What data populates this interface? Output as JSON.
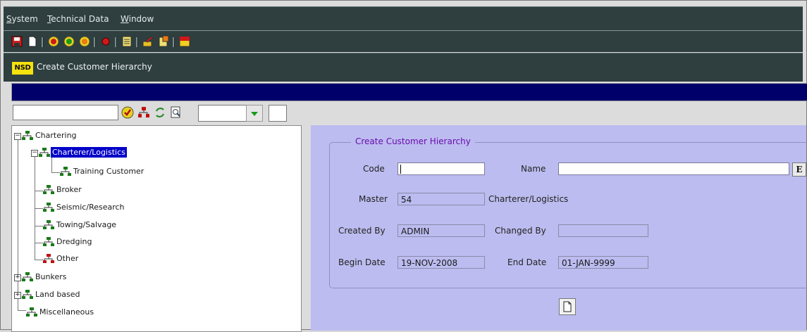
{
  "menu": {
    "system": "System",
    "technical_data": "Technical Data",
    "window": "Window"
  },
  "toolbar": {
    "icons": [
      "save-icon",
      "new-document-icon",
      "first-record-icon",
      "previous-record-icon",
      "next-record-icon",
      "stop-icon",
      "list-icon",
      "edit-icon",
      "attach-icon",
      "exit-icon"
    ]
  },
  "window": {
    "logo": "NSD",
    "title": "Create Customer Hierarchy"
  },
  "tree": {
    "nodes": [
      {
        "label": "Chartering",
        "expanded": true
      },
      {
        "label": "Charterer/Logistics",
        "selected": true,
        "expanded": true
      },
      {
        "label": "Training Customer"
      },
      {
        "label": "Broker"
      },
      {
        "label": "Seismic/Research"
      },
      {
        "label": "Towing/Salvage"
      },
      {
        "label": "Dredging"
      },
      {
        "label": "Other"
      },
      {
        "label": "Bunkers",
        "expanded": false
      },
      {
        "label": "Land based",
        "expanded": false
      },
      {
        "label": "Miscellaneous"
      }
    ]
  },
  "form": {
    "group_title": "Create Customer Hierarchy",
    "code_label": "Code",
    "code_value": "",
    "name_label": "Name",
    "name_value": "",
    "e_button": "E",
    "master_label": "Master",
    "master_value": "54",
    "master_desc": "Charterer/Logistics",
    "created_by_label": "Created By",
    "created_by_value": "ADMIN",
    "changed_by_label": "Changed By",
    "changed_by_value": "",
    "begin_date_label": "Begin Date",
    "begin_date_value": "19-NOV-2008",
    "end_date_label": "End Date",
    "end_date_value": "01-JAN-9999"
  },
  "colors": {
    "chrome": "#2f3f3f",
    "blue_bar": "#00006b",
    "panel": "#bcbcf0",
    "selection": "#0000c8",
    "group_title": "#6a0dad"
  }
}
